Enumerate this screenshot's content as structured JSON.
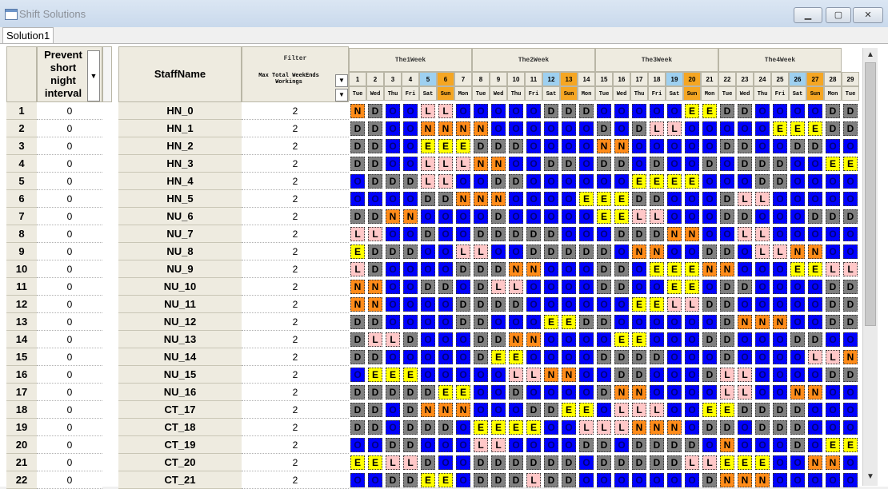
{
  "window": {
    "title": "Shift Solutions",
    "minimize": "▁",
    "maximize": "▢",
    "close": "✕"
  },
  "tab": {
    "label": "Solution1"
  },
  "left_header": {
    "prevent_label": "Prevent short night interval",
    "dropdown_glyph": "▼"
  },
  "staff_header": {
    "label": "StaffName"
  },
  "filter_header": {
    "label": "Filter",
    "sub_label": "Max Total WeekEnds Workings",
    "dropdown_glyph": "▼"
  },
  "weeks": [
    "The1Week",
    "The2Week",
    "The3Week",
    "The4Week"
  ],
  "days": [
    {
      "num": "1",
      "name": "Tue"
    },
    {
      "num": "2",
      "name": "Wed"
    },
    {
      "num": "3",
      "name": "Thu"
    },
    {
      "num": "4",
      "name": "Fri"
    },
    {
      "num": "5",
      "name": "Sat"
    },
    {
      "num": "6",
      "name": "Sun"
    },
    {
      "num": "7",
      "name": "Mon"
    },
    {
      "num": "8",
      "name": "Tue"
    },
    {
      "num": "9",
      "name": "Wed"
    },
    {
      "num": "10",
      "name": "Thu"
    },
    {
      "num": "11",
      "name": "Fri"
    },
    {
      "num": "12",
      "name": "Sat"
    },
    {
      "num": "13",
      "name": "Sun"
    },
    {
      "num": "14",
      "name": "Mon"
    },
    {
      "num": "15",
      "name": "Tue"
    },
    {
      "num": "16",
      "name": "Wed"
    },
    {
      "num": "17",
      "name": "Thu"
    },
    {
      "num": "18",
      "name": "Fri"
    },
    {
      "num": "19",
      "name": "Sat"
    },
    {
      "num": "20",
      "name": "Sun"
    },
    {
      "num": "21",
      "name": "Mon"
    },
    {
      "num": "22",
      "name": "Tue"
    },
    {
      "num": "23",
      "name": "Wed"
    },
    {
      "num": "24",
      "name": "Thu"
    },
    {
      "num": "25",
      "name": "Fri"
    },
    {
      "num": "26",
      "name": "Sat"
    },
    {
      "num": "27",
      "name": "Sun"
    },
    {
      "num": "28",
      "name": "Mon"
    },
    {
      "num": "29",
      "name": "Tue"
    }
  ],
  "colors": {
    "saturday": "#9ed0f0",
    "sunday": "#f5a623",
    "N": "#ff8c1a",
    "D": "#808080",
    "L": "#ffc8c8",
    "E": "#ffff00",
    "O": "#0000ff"
  },
  "rows": [
    {
      "num": "1",
      "prevent": "0",
      "staff": "HN_0",
      "filter": "2",
      "shifts": "NDOOLLOOOOODDDOOOOOEEDDOOOODD"
    },
    {
      "num": "2",
      "prevent": "0",
      "staff": "HN_1",
      "filter": "2",
      "shifts": "DDOONNNNOOOOOODODLLOOOOOEEEDD"
    },
    {
      "num": "3",
      "prevent": "0",
      "staff": "HN_2",
      "filter": "2",
      "shifts": "DDOOEEEDDDOOOONNOOOOODDOODDOO"
    },
    {
      "num": "4",
      "prevent": "0",
      "staff": "HN_3",
      "filter": "2",
      "shifts": "DDOOLLLNNOODDODDODOODODDDOOEE"
    },
    {
      "num": "5",
      "prevent": "0",
      "staff": "HN_4",
      "filter": "2",
      "shifts": "ODDDLLOODDOOOOOOEEEEOOODDOOOO"
    },
    {
      "num": "6",
      "prevent": "0",
      "staff": "HN_5",
      "filter": "2",
      "shifts": "OOOODDNNNOOOOEEEDDOOODLLOOOOO"
    },
    {
      "num": "7",
      "prevent": "0",
      "staff": "NU_6",
      "filter": "2",
      "shifts": "DDNNOOOODOOOOOEELLOOODDOOODDD"
    },
    {
      "num": "8",
      "prevent": "0",
      "staff": "NU_7",
      "filter": "2",
      "shifts": "LLOODOODDDDDOOODDDNNOOLLOOOOO"
    },
    {
      "num": "9",
      "prevent": "0",
      "staff": "NU_8",
      "filter": "2",
      "shifts": "EDDDOOLLOODDDDDONNOODDOLLNNOO"
    },
    {
      "num": "10",
      "prevent": "0",
      "staff": "NU_9",
      "filter": "2",
      "shifts": "LDOOOODDDNNOOODDOEEENNOOOEELL"
    },
    {
      "num": "11",
      "prevent": "0",
      "staff": "NU_10",
      "filter": "2",
      "shifts": "NNOODDODLLOOOODDOOEEODDOOOODD"
    },
    {
      "num": "12",
      "prevent": "0",
      "staff": "NU_11",
      "filter": "2",
      "shifts": "NNOOOODDDDOOOOOOEELLDDOOOOODD"
    },
    {
      "num": "13",
      "prevent": "0",
      "staff": "NU_12",
      "filter": "2",
      "shifts": "DDOOOODDOOOEEDDOOOOOODNNNOODD"
    },
    {
      "num": "14",
      "prevent": "0",
      "staff": "NU_13",
      "filter": "2",
      "shifts": "DLLDOOODDNNOOOOEEOOODDOOODDOO"
    },
    {
      "num": "15",
      "prevent": "0",
      "staff": "NU_14",
      "filter": "2",
      "shifts": "DDOOOOODEEOOOODDDDOOODOOOOLLN"
    },
    {
      "num": "16",
      "prevent": "0",
      "staff": "NU_15",
      "filter": "2",
      "shifts": "OEEEOOOOOLLNNOODDOOODLLOOOODD"
    },
    {
      "num": "17",
      "prevent": "0",
      "staff": "NU_16",
      "filter": "2",
      "shifts": "DDDDDEEOODOOOODNNOOOOLLOONNOO"
    },
    {
      "num": "18",
      "prevent": "0",
      "staff": "CT_17",
      "filter": "2",
      "shifts": "DDODNNNOOODDEEOLLLOOEEDDDDOOO"
    },
    {
      "num": "19",
      "prevent": "0",
      "staff": "CT_18",
      "filter": "2",
      "shifts": "DDODDDOEEEEOOLLLNNNODDODDDOOO"
    },
    {
      "num": "20",
      "prevent": "0",
      "staff": "CT_19",
      "filter": "2",
      "shifts": "OODDOOOLLOOOODDODDDDONOOODOEE"
    },
    {
      "num": "21",
      "prevent": "0",
      "staff": "CT_20",
      "filter": "2",
      "shifts": "EELLDOODDDDDDODDDDDLLEEEOONNO"
    },
    {
      "num": "22",
      "prevent": "0",
      "staff": "CT_21",
      "filter": "2",
      "shifts": "OODDEEODDDLDDOOOOOOODNNNOOOOO"
    }
  ]
}
